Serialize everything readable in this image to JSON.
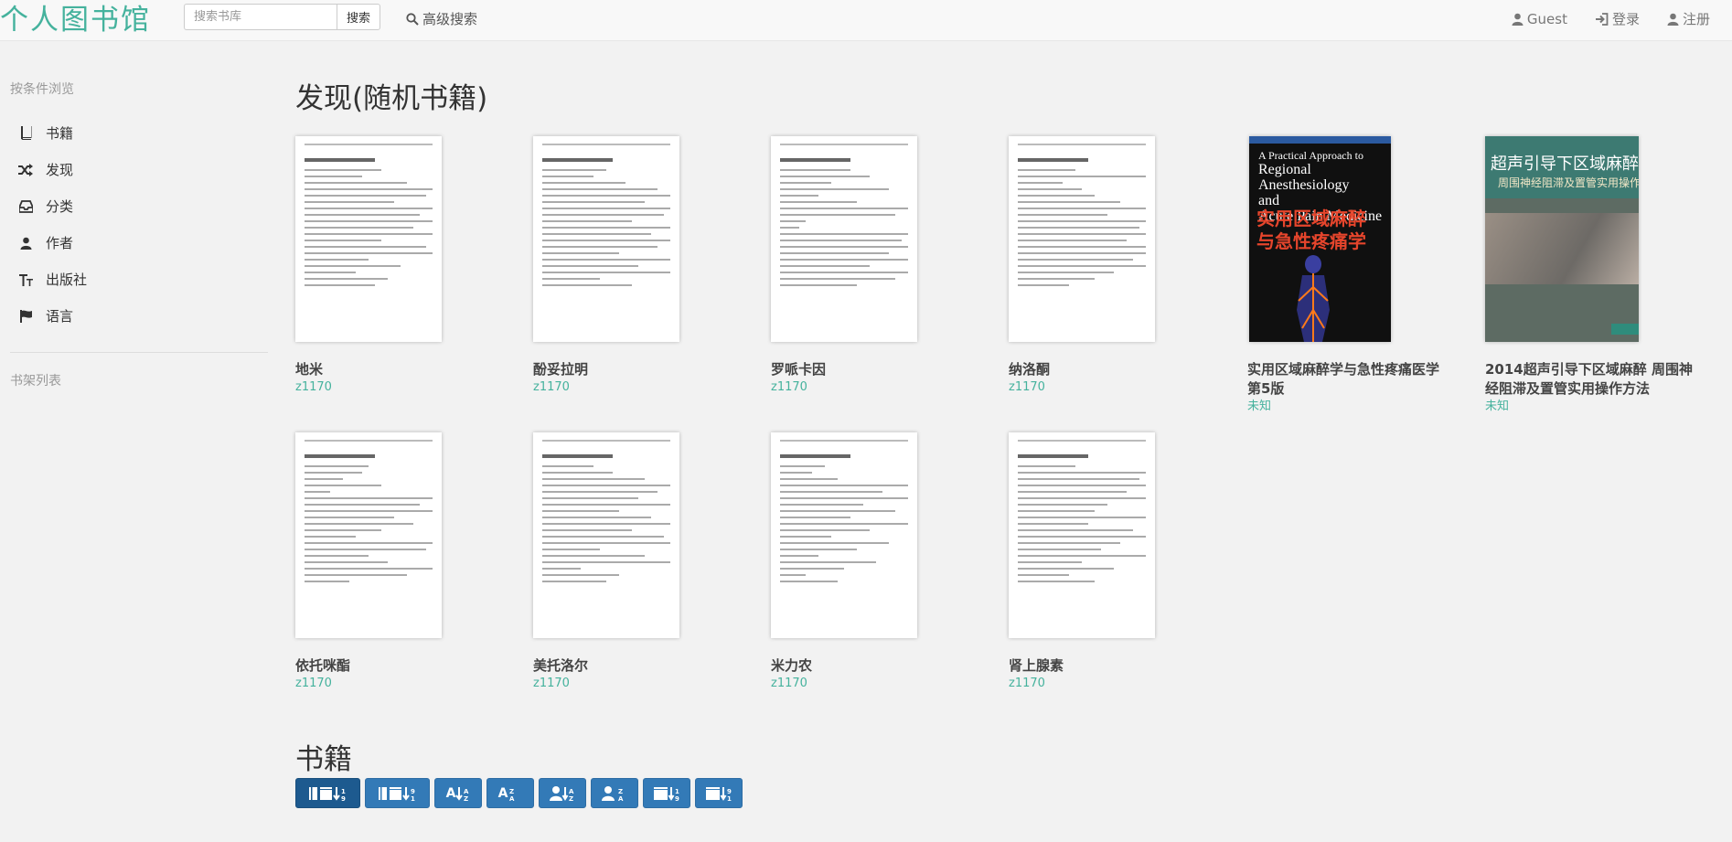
{
  "navbar": {
    "brand": "个人图书馆",
    "search_placeholder": "搜索书库",
    "search_button": "搜索",
    "advanced_search": "高级搜索",
    "right_links": [
      "Guest",
      "登录",
      "注册"
    ]
  },
  "sidebar": {
    "browse_heading": "按条件浏览",
    "items": [
      {
        "label": "书籍",
        "icon": "book-icon"
      },
      {
        "label": "发现",
        "icon": "random-icon"
      },
      {
        "label": "分类",
        "icon": "inbox-icon"
      },
      {
        "label": "作者",
        "icon": "user-icon"
      },
      {
        "label": "出版社",
        "icon": "text-size-icon"
      },
      {
        "label": "语言",
        "icon": "flag-icon"
      }
    ],
    "shelf_heading": "书架列表"
  },
  "discover": {
    "title": "发现(随机书籍)",
    "books": [
      {
        "title": "地米",
        "author": "z1170"
      },
      {
        "title": "酚妥拉明",
        "author": "z1170"
      },
      {
        "title": "罗哌卡因",
        "author": "z1170"
      },
      {
        "title": "纳洛酮",
        "author": "z1170"
      },
      {
        "title": "实用区域麻醉学与急性疼痛医学 第5版",
        "author": "未知"
      },
      {
        "title": "2014超声引导下区域麻醉 周围神经阻滞及置管实用操作方法",
        "author": "未知"
      },
      {
        "title": "依托咪酯",
        "author": "z1170"
      },
      {
        "title": "美托洛尔",
        "author": "z1170"
      },
      {
        "title": "米力农",
        "author": "z1170"
      },
      {
        "title": "肾上腺素",
        "author": "z1170"
      }
    ]
  },
  "covers": {
    "c1_en1": "A Practical Approach to",
    "c1_en2": "Regional Anesthesiology",
    "c1_en3": "and",
    "c1_en4": "Acute Pain Medicine",
    "c1_zh1": "实用区域麻醉",
    "c1_zh2": "与急性疼痛学",
    "c2_zh1": "超声引导下区域麻醉",
    "c2_zh2": "周围神经阻滞及置管实用操作方法"
  },
  "books_section": {
    "title": "书籍",
    "sort_buttons": [
      {
        "label": "",
        "icon": "sort-newest-icon",
        "active": true
      },
      {
        "label": "",
        "icon": "sort-oldest-icon",
        "active": false
      },
      {
        "label": "A",
        "icon": "sort-alpha-asc-icon",
        "active": false
      },
      {
        "label": "A",
        "icon": "sort-alpha-desc-icon",
        "active": false
      },
      {
        "label": "",
        "icon": "sort-author-asc-icon",
        "active": false
      },
      {
        "label": "",
        "icon": "sort-author-desc-icon",
        "active": false
      },
      {
        "label": "",
        "icon": "sort-pubdate-asc-icon",
        "active": false
      },
      {
        "label": "",
        "icon": "sort-pubdate-desc-icon",
        "active": false
      }
    ]
  },
  "colors": {
    "accent": "#45b29d",
    "button": "#337ab7",
    "button_active": "#1d5a8f"
  }
}
